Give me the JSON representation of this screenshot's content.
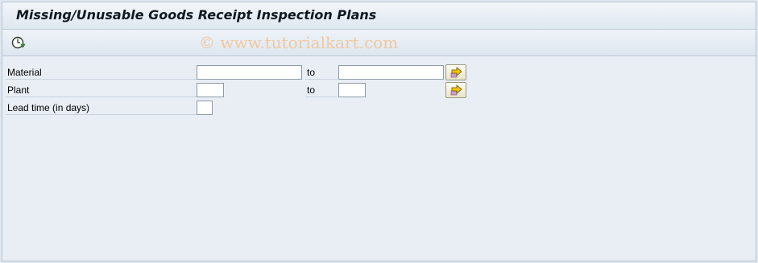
{
  "header": {
    "title": "Missing/Unusable Goods Receipt Inspection Plans"
  },
  "toolbar": {
    "execute_icon": "clock-execute-icon"
  },
  "watermark": "© www.tutorialkart.com",
  "selection": {
    "material": {
      "label": "Material",
      "from_value": "",
      "to_label": "to",
      "to_value": "",
      "multi_icon": "arrow-right-icon"
    },
    "plant": {
      "label": "Plant",
      "from_value": "",
      "to_label": "to",
      "to_value": "",
      "multi_icon": "arrow-right-icon"
    },
    "lead_time": {
      "label": "Lead time (in days)",
      "value": ""
    }
  },
  "colors": {
    "background": "#e8eef4",
    "title_bar": "#dfe7ef",
    "multi_button": "#e8e4c8",
    "arrow": "#e6b400"
  }
}
